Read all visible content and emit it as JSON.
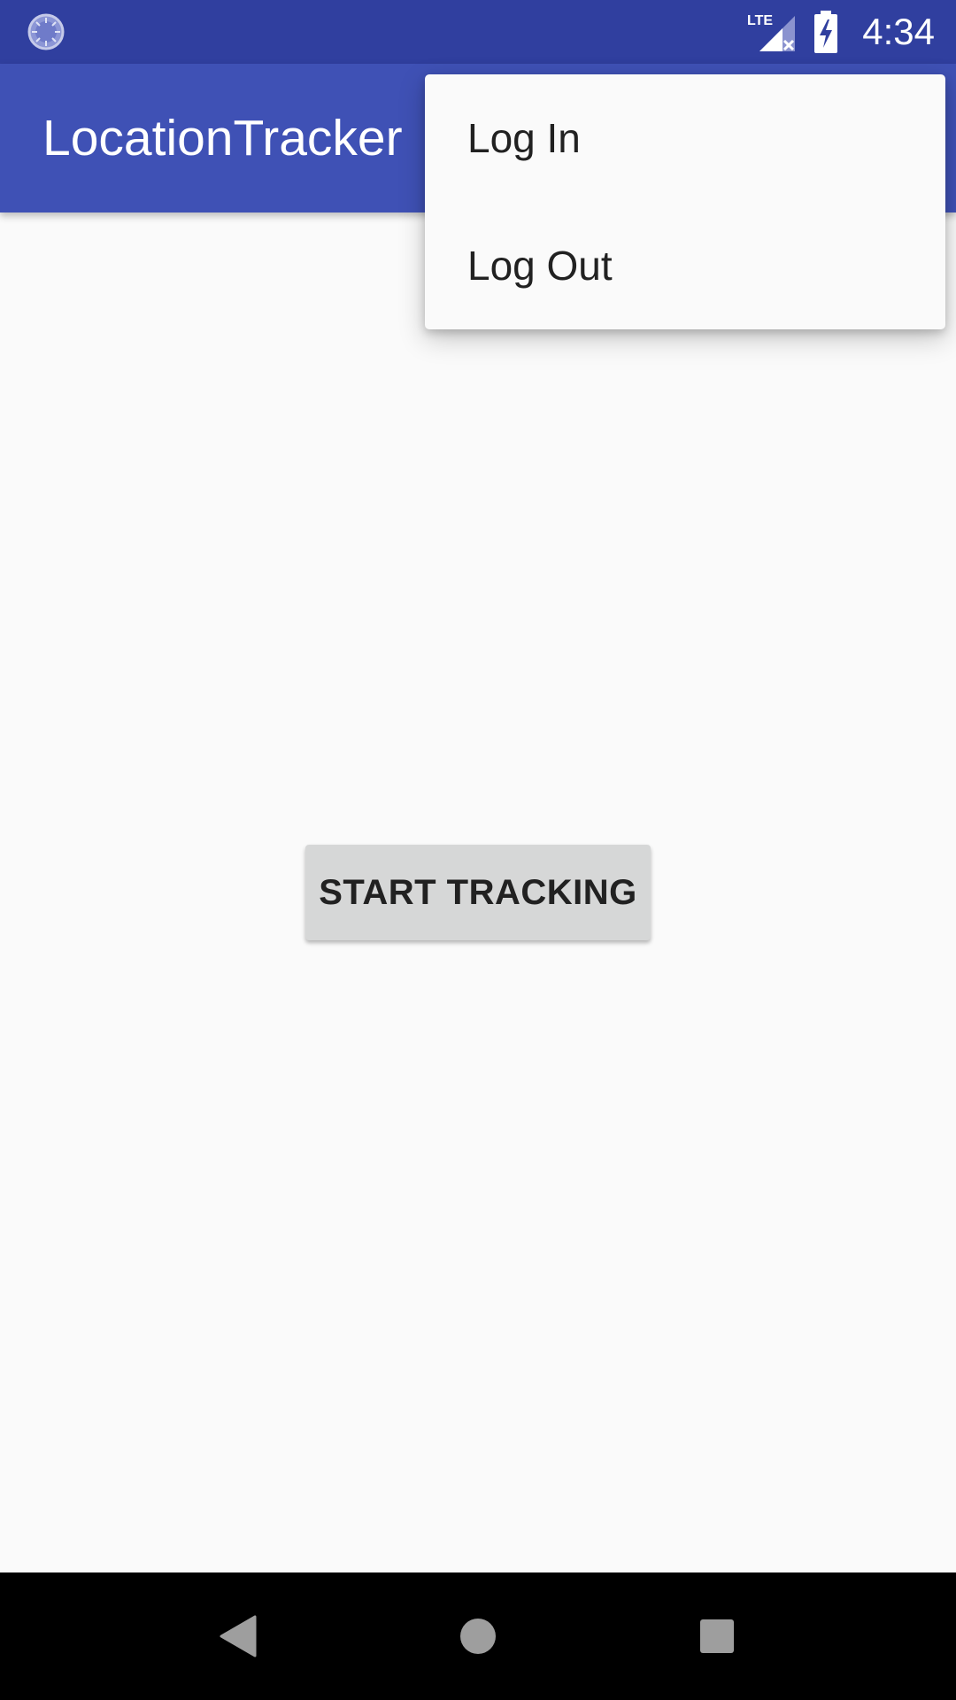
{
  "status_bar": {
    "left_icon": "loading-spinner-icon",
    "network_label": "LTE",
    "network_icon": "signal-no-service-icon",
    "battery_icon": "battery-charging-icon",
    "time": "4:34",
    "background_color": "#303f9f"
  },
  "app_bar": {
    "title": "LocationTracker",
    "background_color": "#3f51b5"
  },
  "overflow_menu": {
    "items": [
      {
        "label": "Log In"
      },
      {
        "label": "Log Out"
      }
    ]
  },
  "main": {
    "start_button_label": "START TRACKING"
  },
  "nav_bar": {
    "back_icon": "back-triangle-icon",
    "home_icon": "home-circle-icon",
    "recents_icon": "recents-square-icon"
  }
}
